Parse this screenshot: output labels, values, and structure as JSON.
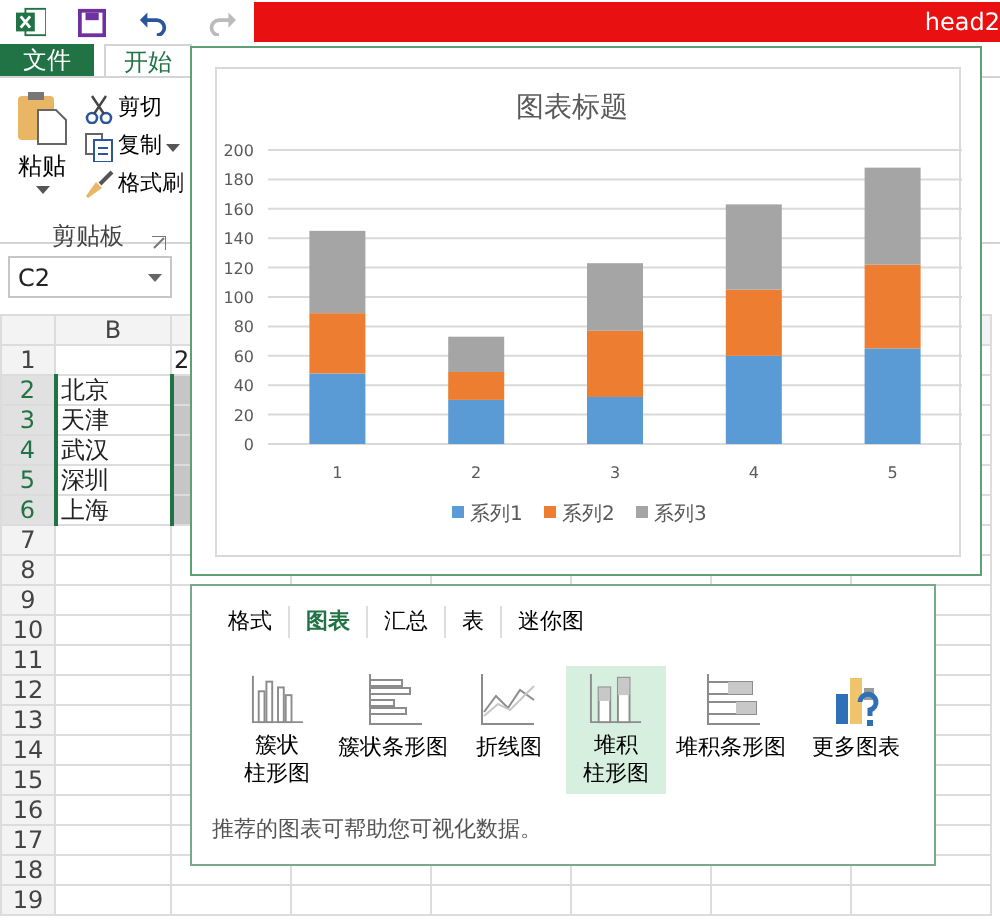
{
  "title_bar": {
    "title": "head2"
  },
  "ribbon_tabs": [
    {
      "label": "文件",
      "kind": "file",
      "selected": false
    },
    {
      "label": "开始",
      "kind": "tab",
      "selected": true
    }
  ],
  "clipboard_group": {
    "paste": "粘贴",
    "commands": [
      {
        "label": "剪切",
        "kind": "cut",
        "dropdown": false
      },
      {
        "label": "复制",
        "kind": "copy",
        "dropdown": true
      },
      {
        "label": "格式刷",
        "kind": "brush",
        "dropdown": false
      }
    ],
    "label": "剪贴板"
  },
  "name_box": {
    "value": "C2"
  },
  "sheet": {
    "columns": [
      "B"
    ],
    "rows": [
      {
        "number": "1",
        "selected": false,
        "b": "",
        "c": "2"
      },
      {
        "number": "2",
        "selected": true,
        "b": "北京",
        "c": ""
      },
      {
        "number": "3",
        "selected": true,
        "b": "天津",
        "c": ""
      },
      {
        "number": "4",
        "selected": true,
        "b": "武汉",
        "c": ""
      },
      {
        "number": "5",
        "selected": true,
        "b": "深圳",
        "c": ""
      },
      {
        "number": "6",
        "selected": true,
        "b": "上海",
        "c": ""
      },
      {
        "number": "7",
        "selected": false,
        "b": "",
        "c": ""
      },
      {
        "number": "8",
        "selected": false,
        "b": "",
        "c": ""
      },
      {
        "number": "9",
        "selected": false,
        "b": "",
        "c": ""
      },
      {
        "number": "10",
        "selected": false,
        "b": "",
        "c": ""
      },
      {
        "number": "11",
        "selected": false,
        "b": "",
        "c": ""
      },
      {
        "number": "12",
        "selected": false,
        "b": "",
        "c": ""
      },
      {
        "number": "13",
        "selected": false,
        "b": "",
        "c": ""
      },
      {
        "number": "14",
        "selected": false,
        "b": "",
        "c": ""
      },
      {
        "number": "15",
        "selected": false,
        "b": "",
        "c": ""
      },
      {
        "number": "16",
        "selected": false,
        "b": "",
        "c": ""
      },
      {
        "number": "17",
        "selected": false,
        "b": "",
        "c": ""
      },
      {
        "number": "18",
        "selected": false,
        "b": "",
        "c": ""
      },
      {
        "number": "19",
        "selected": false,
        "b": "",
        "c": ""
      }
    ]
  },
  "chart": {
    "chart_data": {
      "type": "bar",
      "stacked": true,
      "grid": true,
      "legend": "bottom",
      "title": "图表标题",
      "categories": [
        "1",
        "2",
        "3",
        "4",
        "5"
      ],
      "ylim": [
        0,
        200
      ],
      "yticks": [
        0,
        20,
        40,
        60,
        80,
        100,
        120,
        140,
        160,
        180,
        200
      ],
      "series": [
        {
          "name": "系列1",
          "color": "#5b9bd5",
          "values": [
            48,
            30,
            32,
            60,
            65
          ]
        },
        {
          "name": "系列2",
          "color": "#ed7d31",
          "values": [
            41,
            19,
            45,
            45,
            57
          ]
        },
        {
          "name": "系列3",
          "color": "#a5a5a5",
          "values": [
            56,
            24,
            46,
            58,
            66
          ]
        }
      ]
    }
  },
  "quick_analysis": {
    "tabs": [
      {
        "label": "格式",
        "selected": false
      },
      {
        "label": "图表",
        "selected": true
      },
      {
        "label": "汇总",
        "selected": false
      },
      {
        "label": "表",
        "selected": false
      },
      {
        "label": "迷你图",
        "selected": false
      }
    ],
    "options": [
      {
        "kind": "clustered-column",
        "label_lines": [
          "簇状",
          "柱形图"
        ],
        "selected": false
      },
      {
        "kind": "clustered-bar",
        "label_lines": [
          "簇状条形图"
        ],
        "selected": false
      },
      {
        "kind": "line",
        "label_lines": [
          "折线图"
        ],
        "selected": false
      },
      {
        "kind": "stacked-column",
        "label_lines": [
          "堆积",
          "柱形图"
        ],
        "selected": true
      },
      {
        "kind": "stacked-bar",
        "label_lines": [
          "堆积条形图"
        ],
        "selected": false
      },
      {
        "kind": "more",
        "label_lines": [
          "更多图表"
        ],
        "selected": false
      }
    ],
    "hint": "推荐的图表可帮助您可视化数据。"
  }
}
